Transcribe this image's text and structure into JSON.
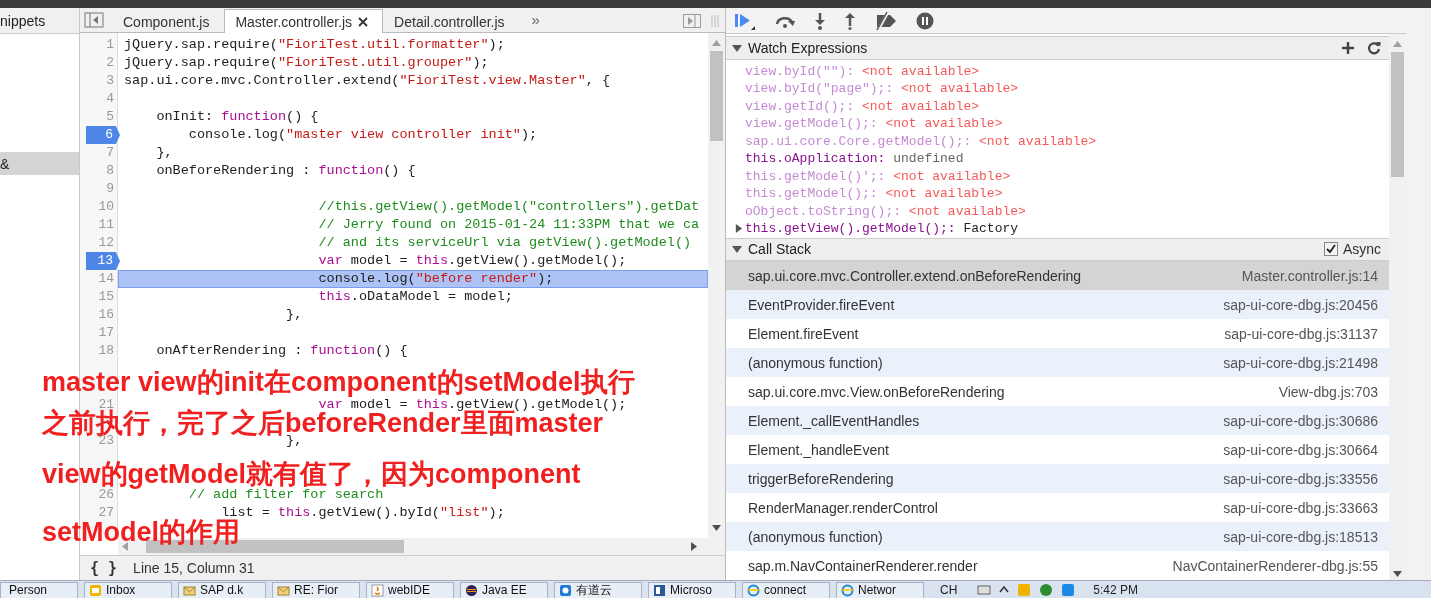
{
  "sidebar": {
    "header": "nippets",
    "items": [
      {
        "label": "&",
        "selected": true
      }
    ]
  },
  "editor": {
    "tabs": [
      {
        "label": "Component.js",
        "selected": false,
        "closable": false
      },
      {
        "label": "Master.controller.js",
        "selected": true,
        "closable": true
      },
      {
        "label": "Detail.controller.js",
        "selected": false,
        "closable": false
      }
    ],
    "overflow": "»",
    "lines": [
      {
        "kind": "code",
        "number": "1",
        "breakpoint": false,
        "current": false,
        "tokens": [
          {
            "kind": "plain",
            "text": "jQuery.sap.require("
          },
          {
            "kind": "string",
            "text": "\"FioriTest.util.formatter\""
          },
          {
            "kind": "plain",
            "text": ");"
          }
        ]
      },
      {
        "kind": "code",
        "number": "2",
        "breakpoint": false,
        "current": false,
        "tokens": [
          {
            "kind": "plain",
            "text": "jQuery.sap.require("
          },
          {
            "kind": "string",
            "text": "\"FioriTest.util.grouper\""
          },
          {
            "kind": "plain",
            "text": ");"
          }
        ]
      },
      {
        "kind": "code",
        "number": "3",
        "breakpoint": false,
        "current": false,
        "tokens": [
          {
            "kind": "plain",
            "text": "sap.ui.core.mvc.Controller.extend("
          },
          {
            "kind": "string",
            "text": "\"FioriTest.view.Master\""
          },
          {
            "kind": "plain",
            "text": ", {"
          }
        ]
      },
      {
        "kind": "code",
        "number": "4",
        "breakpoint": false,
        "current": false
      },
      {
        "kind": "code",
        "number": "5",
        "breakpoint": false,
        "current": false,
        "tokens": [
          {
            "kind": "plain",
            "text": "    onInit: "
          },
          {
            "kind": "keyword",
            "text": "function"
          },
          {
            "kind": "plain",
            "text": "() {"
          }
        ]
      },
      {
        "kind": "code",
        "number": "6",
        "breakpoint": true,
        "current": false,
        "tokens": [
          {
            "kind": "plain",
            "text": "        console.log("
          },
          {
            "kind": "string",
            "text": "\"master view controller init\""
          },
          {
            "kind": "plain",
            "text": ");"
          }
        ]
      },
      {
        "kind": "code",
        "number": "7",
        "breakpoint": false,
        "current": false,
        "tokens": [
          {
            "kind": "plain",
            "text": "    },"
          }
        ]
      },
      {
        "kind": "code",
        "number": "8",
        "breakpoint": false,
        "current": false,
        "tokens": [
          {
            "kind": "plain",
            "text": "    onBeforeRendering : "
          },
          {
            "kind": "keyword",
            "text": "function"
          },
          {
            "kind": "plain",
            "text": "() {"
          }
        ]
      },
      {
        "kind": "code",
        "number": "9",
        "breakpoint": false,
        "current": false
      },
      {
        "kind": "code",
        "number": "10",
        "breakpoint": false,
        "current": false,
        "tokens": [
          {
            "kind": "comment",
            "text": "                        //this.getView().getModel(\"controllers\").getDat"
          }
        ]
      },
      {
        "kind": "code",
        "number": "11",
        "breakpoint": false,
        "current": false,
        "tokens": [
          {
            "kind": "comment",
            "text": "                        // Jerry found on 2015-01-24 11:33PM that we ca"
          }
        ]
      },
      {
        "kind": "code",
        "number": "12",
        "breakpoint": false,
        "current": false,
        "tokens": [
          {
            "kind": "comment",
            "text": "                        // and its serviceUrl via getView().getModel()"
          }
        ]
      },
      {
        "kind": "code",
        "number": "13",
        "breakpoint": true,
        "current": false,
        "tokens": [
          {
            "kind": "keyword",
            "text": "                        var"
          },
          {
            "kind": "plain",
            "text": " model = "
          },
          {
            "kind": "keyword",
            "text": "this"
          },
          {
            "kind": "plain",
            "text": ".getView().getModel();"
          }
        ]
      },
      {
        "kind": "code",
        "number": "14",
        "breakpoint": false,
        "current": true,
        "tokens": [
          {
            "kind": "plain",
            "text": "                        console.log("
          },
          {
            "kind": "string",
            "text": "\"before render\""
          },
          {
            "kind": "plain",
            "text": ");"
          }
        ]
      },
      {
        "kind": "code",
        "number": "15",
        "breakpoint": false,
        "current": false,
        "tokens": [
          {
            "kind": "keyword",
            "text": "                        this"
          },
          {
            "kind": "plain",
            "text": ".oDataModel = model;"
          }
        ]
      },
      {
        "kind": "code",
        "number": "16",
        "breakpoint": false,
        "current": false,
        "tokens": [
          {
            "kind": "plain",
            "text": "                    },"
          }
        ]
      },
      {
        "kind": "code",
        "number": "17",
        "breakpoint": false,
        "current": false
      },
      {
        "kind": "code",
        "number": "18",
        "breakpoint": false,
        "current": false,
        "tokens": [
          {
            "kind": "plain",
            "text": "    onAfterRendering : "
          },
          {
            "kind": "keyword",
            "text": "function"
          },
          {
            "kind": "plain",
            "text": "() {"
          }
        ]
      },
      {
        "kind": "covered"
      },
      {
        "kind": "covered"
      },
      {
        "kind": "code",
        "number": "21",
        "breakpoint": false,
        "current": false,
        "tokens": [
          {
            "kind": "keyword",
            "text": "                        var"
          },
          {
            "kind": "plain",
            "text": " model = "
          },
          {
            "kind": "keyword",
            "text": "this"
          },
          {
            "kind": "plain",
            "text": ".getView().getModel();"
          }
        ]
      },
      {
        "kind": "covered"
      },
      {
        "kind": "code",
        "number": "23",
        "breakpoint": false,
        "current": false,
        "tokens": [
          {
            "kind": "plain",
            "text": "                    },"
          }
        ]
      },
      {
        "kind": "covered"
      },
      {
        "kind": "covered"
      },
      {
        "kind": "code",
        "number": "26",
        "breakpoint": false,
        "current": false,
        "tokens": [
          {
            "kind": "comment",
            "text": "        // add filter for search"
          }
        ]
      },
      {
        "kind": "code",
        "number": "27",
        "breakpoint": false,
        "current": false,
        "tokens": [
          {
            "kind": "plain",
            "text": "            list = "
          },
          {
            "kind": "keyword",
            "text": "this"
          },
          {
            "kind": "plain",
            "text": ".getView().byId("
          },
          {
            "kind": "string",
            "text": "\"list\""
          },
          {
            "kind": "plain",
            "text": ");"
          }
        ]
      },
      {
        "kind": "covered"
      }
    ],
    "status": {
      "brace": "{ }",
      "position": "Line 15, Column 31"
    }
  },
  "annotation": {
    "lines": [
      "master view的init在component的setModel执行",
      "之前执行，完了之后beforeRender里面master",
      "view的getModel就有值了，因为component",
      "setModel的作用"
    ]
  },
  "debugger": {
    "watch": {
      "title": "Watch Expressions",
      "expanded": true,
      "items": [
        {
          "kind": "error",
          "expression": "view.byId(\"\"):",
          "value": "<not available>"
        },
        {
          "kind": "error",
          "expression": "view.byId(\"page\");:",
          "value": "<not available>"
        },
        {
          "kind": "error",
          "expression": "view.getId();:",
          "value": "<not available>"
        },
        {
          "kind": "error",
          "expression": "view.getModel();:",
          "value": "<not available>"
        },
        {
          "kind": "error",
          "expression": "sap.ui.core.Core.getModel();:",
          "value": "<not available>"
        },
        {
          "kind": "value",
          "expression": "this.oApplication:",
          "value": "undefined"
        },
        {
          "kind": "error",
          "expression": "this.getModel()';:",
          "value": "<not available>"
        },
        {
          "kind": "error",
          "expression": "this.getModel();:",
          "value": "<not available>"
        },
        {
          "kind": "error",
          "expression": "oObject.toString();:",
          "value": "<not available>"
        },
        {
          "kind": "object",
          "expanded": false,
          "expression": "this.getView().getModel();:",
          "value": "Factory"
        }
      ]
    },
    "call_stack": {
      "title": "Call Stack",
      "expanded": true,
      "async": {
        "label": "Async",
        "checked": true
      },
      "frames": [
        {
          "name": "sap.ui.core.mvc.Controller.extend.onBeforeRendering",
          "location": "Master.controller.js:14",
          "selected": true
        },
        {
          "name": "EventProvider.fireEvent",
          "location": "sap-ui-core-dbg.js:20456",
          "selected": false
        },
        {
          "name": "Element.fireEvent",
          "location": "sap-ui-core-dbg.js:31137",
          "selected": false
        },
        {
          "name": "(anonymous function)",
          "location": "sap-ui-core-dbg.js:21498",
          "selected": false
        },
        {
          "name": "sap.ui.core.mvc.View.onBeforeRendering",
          "location": "View-dbg.js:703",
          "selected": false
        },
        {
          "name": "Element._callEventHandles",
          "location": "sap-ui-core-dbg.js:30686",
          "selected": false
        },
        {
          "name": "Element._handleEvent",
          "location": "sap-ui-core-dbg.js:30664",
          "selected": false
        },
        {
          "name": "triggerBeforeRendering",
          "location": "sap-ui-core-dbg.js:33556",
          "selected": false
        },
        {
          "name": "RenderManager.renderControl",
          "location": "sap-ui-core-dbg.js:33663",
          "selected": false
        },
        {
          "name": "(anonymous function)",
          "location": "sap-ui-core-dbg.js:18513",
          "selected": false
        },
        {
          "name": "sap.m.NavContainerRenderer.render",
          "location": "NavContainerRenderer-dbg.js:55",
          "selected": false
        }
      ]
    }
  },
  "taskbar": {
    "items": [
      {
        "kind": "none",
        "label": "Person"
      },
      {
        "kind": "outlook",
        "label": "Inbox"
      },
      {
        "kind": "mail",
        "label": "SAP d.k"
      },
      {
        "kind": "mail",
        "label": "RE: Fior"
      },
      {
        "kind": "java",
        "label": "webIDE"
      },
      {
        "kind": "eclipse",
        "label": "Java EE"
      },
      {
        "kind": "note",
        "label": "有道云"
      },
      {
        "kind": "doc",
        "label": "Microso"
      },
      {
        "kind": "browser",
        "label": "connect"
      },
      {
        "kind": "browser",
        "label": "Networ"
      }
    ],
    "language": "CH",
    "clock": "5:42 PM"
  }
}
